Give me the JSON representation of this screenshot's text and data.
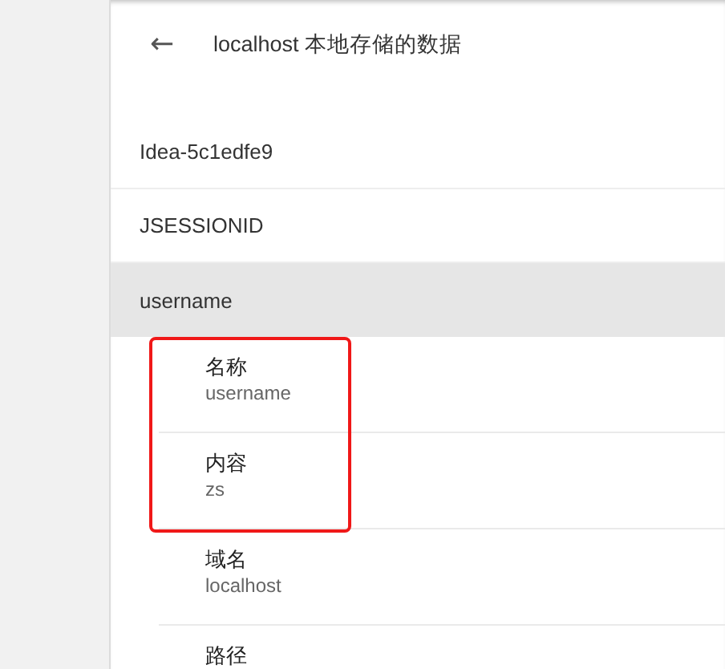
{
  "header": {
    "back_icon": "←",
    "title": "localhost 本地存储的数据"
  },
  "items": [
    {
      "name": "Idea-5c1edfe9",
      "selected": false
    },
    {
      "name": "JSESSIONID",
      "selected": false
    },
    {
      "name": "username",
      "selected": true
    }
  ],
  "details": [
    {
      "label": "名称",
      "value": "username",
      "highlighted": true
    },
    {
      "label": "内容",
      "value": "zs",
      "highlighted": true
    },
    {
      "label": "域名",
      "value": "localhost",
      "highlighted": false
    },
    {
      "label": "路径",
      "highlighted": false
    }
  ]
}
